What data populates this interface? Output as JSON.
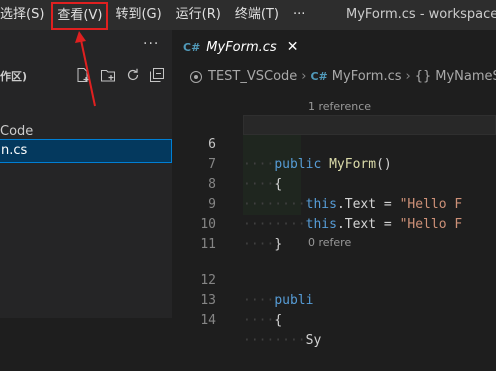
{
  "menubar": {
    "items": [
      {
        "label": "选择(S)"
      },
      {
        "label": "查看(V)"
      },
      {
        "label": "转到(G)"
      },
      {
        "label": "运行(R)"
      },
      {
        "label": "终端(T)"
      },
      {
        "label": "···"
      }
    ],
    "highlighted_index": 1,
    "window_title": "MyForm.cs - workspace (工"
  },
  "sidebar": {
    "more": "···",
    "section_header": "作区)",
    "actions": [
      "new-file-icon",
      "new-folder-icon",
      "refresh-icon",
      "collapse-all-icon"
    ],
    "folder_label": "Code",
    "file_label": "n.cs"
  },
  "editor": {
    "tab": {
      "badge": "C#",
      "label": "MyForm.cs",
      "close": "✕"
    },
    "breadcrumb": {
      "root": "TEST_VSCode",
      "sep": "›",
      "file_badge": "C#",
      "file": "MyForm.cs",
      "namespace_icon": "{}",
      "namespace": "MyNameS"
    },
    "codelens": [
      "1 reference",
      "0 refere"
    ],
    "lines": [
      {
        "num": "6",
        "text_kw": "public",
        "text_fn": "MyForm",
        "text_rest": "()"
      },
      {
        "num": "7",
        "text": "{"
      },
      {
        "num": "8",
        "kw": "this",
        "rest": ".Text = ",
        "str": "\"Hello F"
      },
      {
        "num": "9",
        "kw": "this",
        "rest": ".Text = ",
        "str": "\"Hello F"
      },
      {
        "num": "10",
        "text": "}"
      },
      {
        "num": "11",
        "text": ""
      },
      {
        "num": "12",
        "text_kw": "publi"
      },
      {
        "num": "13",
        "text": "{"
      },
      {
        "num": "14",
        "text": "Sy"
      }
    ]
  },
  "colors": {
    "highlight_border": "#e02020",
    "selection": "#04395e",
    "keyword": "#569cd6",
    "function": "#dcdcaa",
    "string": "#ce9178"
  }
}
